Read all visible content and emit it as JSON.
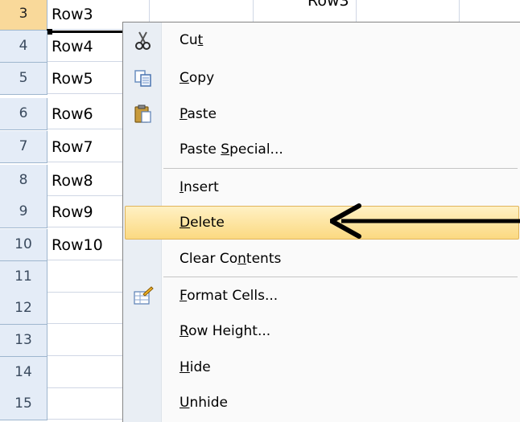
{
  "grid": {
    "rows": [
      {
        "num": "3",
        "a": "Row3",
        "selected": true
      },
      {
        "num": "4",
        "a": "Row4"
      },
      {
        "num": "5",
        "a": "Row5"
      },
      {
        "num": "6",
        "a": "Row6"
      },
      {
        "num": "7",
        "a": "Row7"
      },
      {
        "num": "8",
        "a": "Row8"
      },
      {
        "num": "9",
        "a": "Row9"
      },
      {
        "num": "10",
        "a": "Row10"
      },
      {
        "num": "11",
        "a": ""
      },
      {
        "num": "12",
        "a": ""
      },
      {
        "num": "13",
        "a": ""
      },
      {
        "num": "14",
        "a": ""
      },
      {
        "num": "15",
        "a": ""
      }
    ],
    "b3": "Row3"
  },
  "menu": {
    "items": [
      {
        "pre": "Cu",
        "u": "t",
        "post": "",
        "icon": "scissors-icon"
      },
      {
        "pre": "",
        "u": "C",
        "post": "opy",
        "icon": "copy-icon"
      },
      {
        "pre": "",
        "u": "P",
        "post": "aste",
        "icon": "clipboard-icon"
      },
      {
        "pre": "Paste ",
        "u": "S",
        "post": "pecial...",
        "icon": ""
      },
      {
        "pre": "",
        "u": "I",
        "post": "nsert",
        "icon": ""
      },
      {
        "pre": "",
        "u": "D",
        "post": "elete",
        "icon": "",
        "highlighted": true
      },
      {
        "pre": "Clear Co",
        "u": "n",
        "post": "tents",
        "icon": ""
      },
      {
        "pre": "",
        "u": "F",
        "post": "ormat Cells...",
        "icon": "format-cells-icon"
      },
      {
        "pre": "",
        "u": "R",
        "post": "ow Height...",
        "icon": ""
      },
      {
        "pre": "",
        "u": "H",
        "post": "ide",
        "icon": ""
      },
      {
        "pre": "",
        "u": "U",
        "post": "nhide",
        "icon": ""
      }
    ]
  },
  "colors": {
    "highlight": "#fbd981",
    "row_header": "#e4ecf7",
    "arrow": "#000000"
  }
}
